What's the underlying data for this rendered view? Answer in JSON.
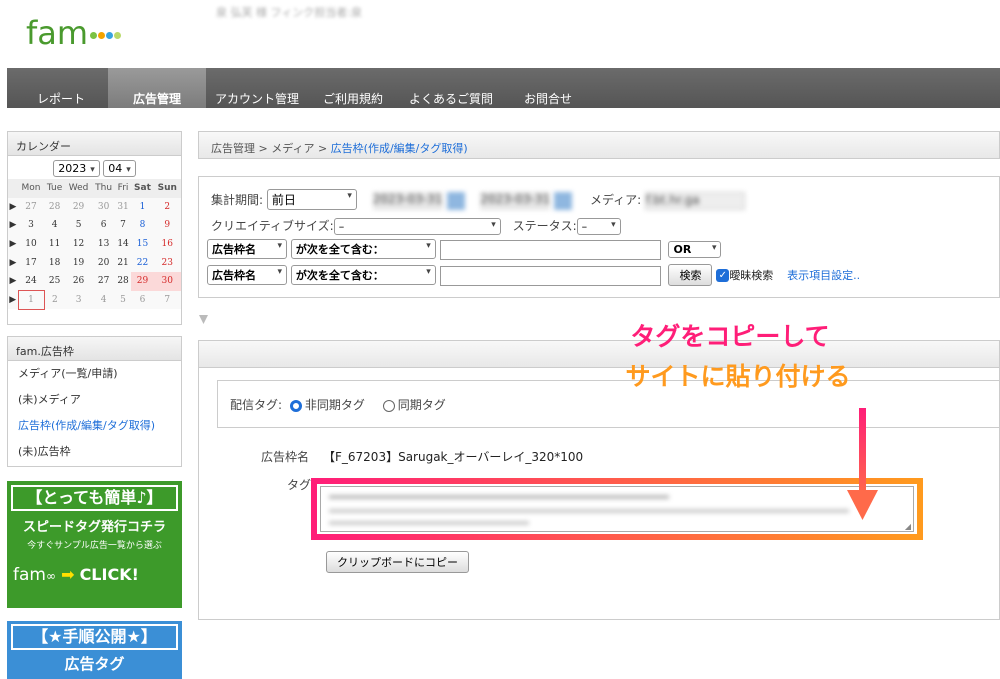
{
  "header": {
    "logo": "fam",
    "user_text": "泉 弘芙 様  フィンク担当者:泉"
  },
  "nav": [
    "レポート",
    "広告管理",
    "アカウント管理",
    "ご利用規約",
    "よくあるご質問",
    "お問合せ"
  ],
  "calendar": {
    "title": "カレンダー",
    "year": "2023",
    "month": "04",
    "weekdays": [
      "Mon",
      "Tue",
      "Wed",
      "Thu",
      "Fri",
      "Sat",
      "Sun"
    ],
    "weeks": [
      [
        "27",
        "28",
        "29",
        "30",
        "31",
        "1",
        "2"
      ],
      [
        "3",
        "4",
        "5",
        "6",
        "7",
        "8",
        "9"
      ],
      [
        "10",
        "11",
        "12",
        "13",
        "14",
        "15",
        "16"
      ],
      [
        "17",
        "18",
        "19",
        "20",
        "21",
        "22",
        "23"
      ],
      [
        "24",
        "25",
        "26",
        "27",
        "28",
        "29",
        "30"
      ],
      [
        "1",
        "2",
        "3",
        "4",
        "5",
        "6",
        "7"
      ]
    ]
  },
  "ad_menu": {
    "title": "fam.広告枠",
    "items": [
      "メディア(一覧/申請)",
      "(未)メディア",
      "広告枠(作成/編集/タグ取得)",
      "(未)広告枠"
    ]
  },
  "banner1": {
    "line1": "【とっても簡単♪】",
    "line2": "スピードタグ発行コチラ",
    "line3": "今すぐサンプル広告一覧から選ぶ",
    "logo": "fam",
    "click": "CLICK!"
  },
  "banner2": {
    "line1": "【★手順公開★】",
    "line2": "広告タグ"
  },
  "breadcrumb": {
    "part1": "広告管理",
    "sep": " > ",
    "part2": "メディア",
    "current": "広告枠(作成/編集/タグ取得)"
  },
  "search": {
    "period_label": "集計期間:",
    "period_value": "前日",
    "date_from": "2023-03-31",
    "date_to": "2023-03-31",
    "media_label": "メディア:",
    "media_value": "f.bt.hr.ga",
    "creative_label": "クリエイティブサイズ:",
    "creative_value": "–",
    "status_label": "ステータス:",
    "status_value": "–",
    "field1": "広告枠名",
    "cond1": "が次を全て含む：",
    "logic": "OR",
    "field2": "広告枠名",
    "cond2": "が次を全て含む：",
    "search_button": "検索",
    "fuzzy_label": "曖昧検索",
    "display_settings": "表示項目設定.."
  },
  "detail": {
    "delivery_label": "配信タグ:",
    "async_label": "非同期タグ",
    "sync_label": "同期タグ",
    "slot_label": "広告枠名",
    "slot_value": "【F_67203】Sarugak_オーバーレイ_320*100",
    "tag_label": "タグ",
    "copy_button": "クリップボードにコピー"
  },
  "annotation": {
    "line1": "タグをコピーして",
    "line2": "サイトに貼り付ける"
  },
  "colors": {
    "nav_bg": "#5e5e5e",
    "link": "#1e6ed8",
    "annot_pink": "#ff1e78",
    "annot_orange": "#ff9a1e",
    "banner_green": "#3d9a2a",
    "banner_blue": "#3b8fd6"
  }
}
